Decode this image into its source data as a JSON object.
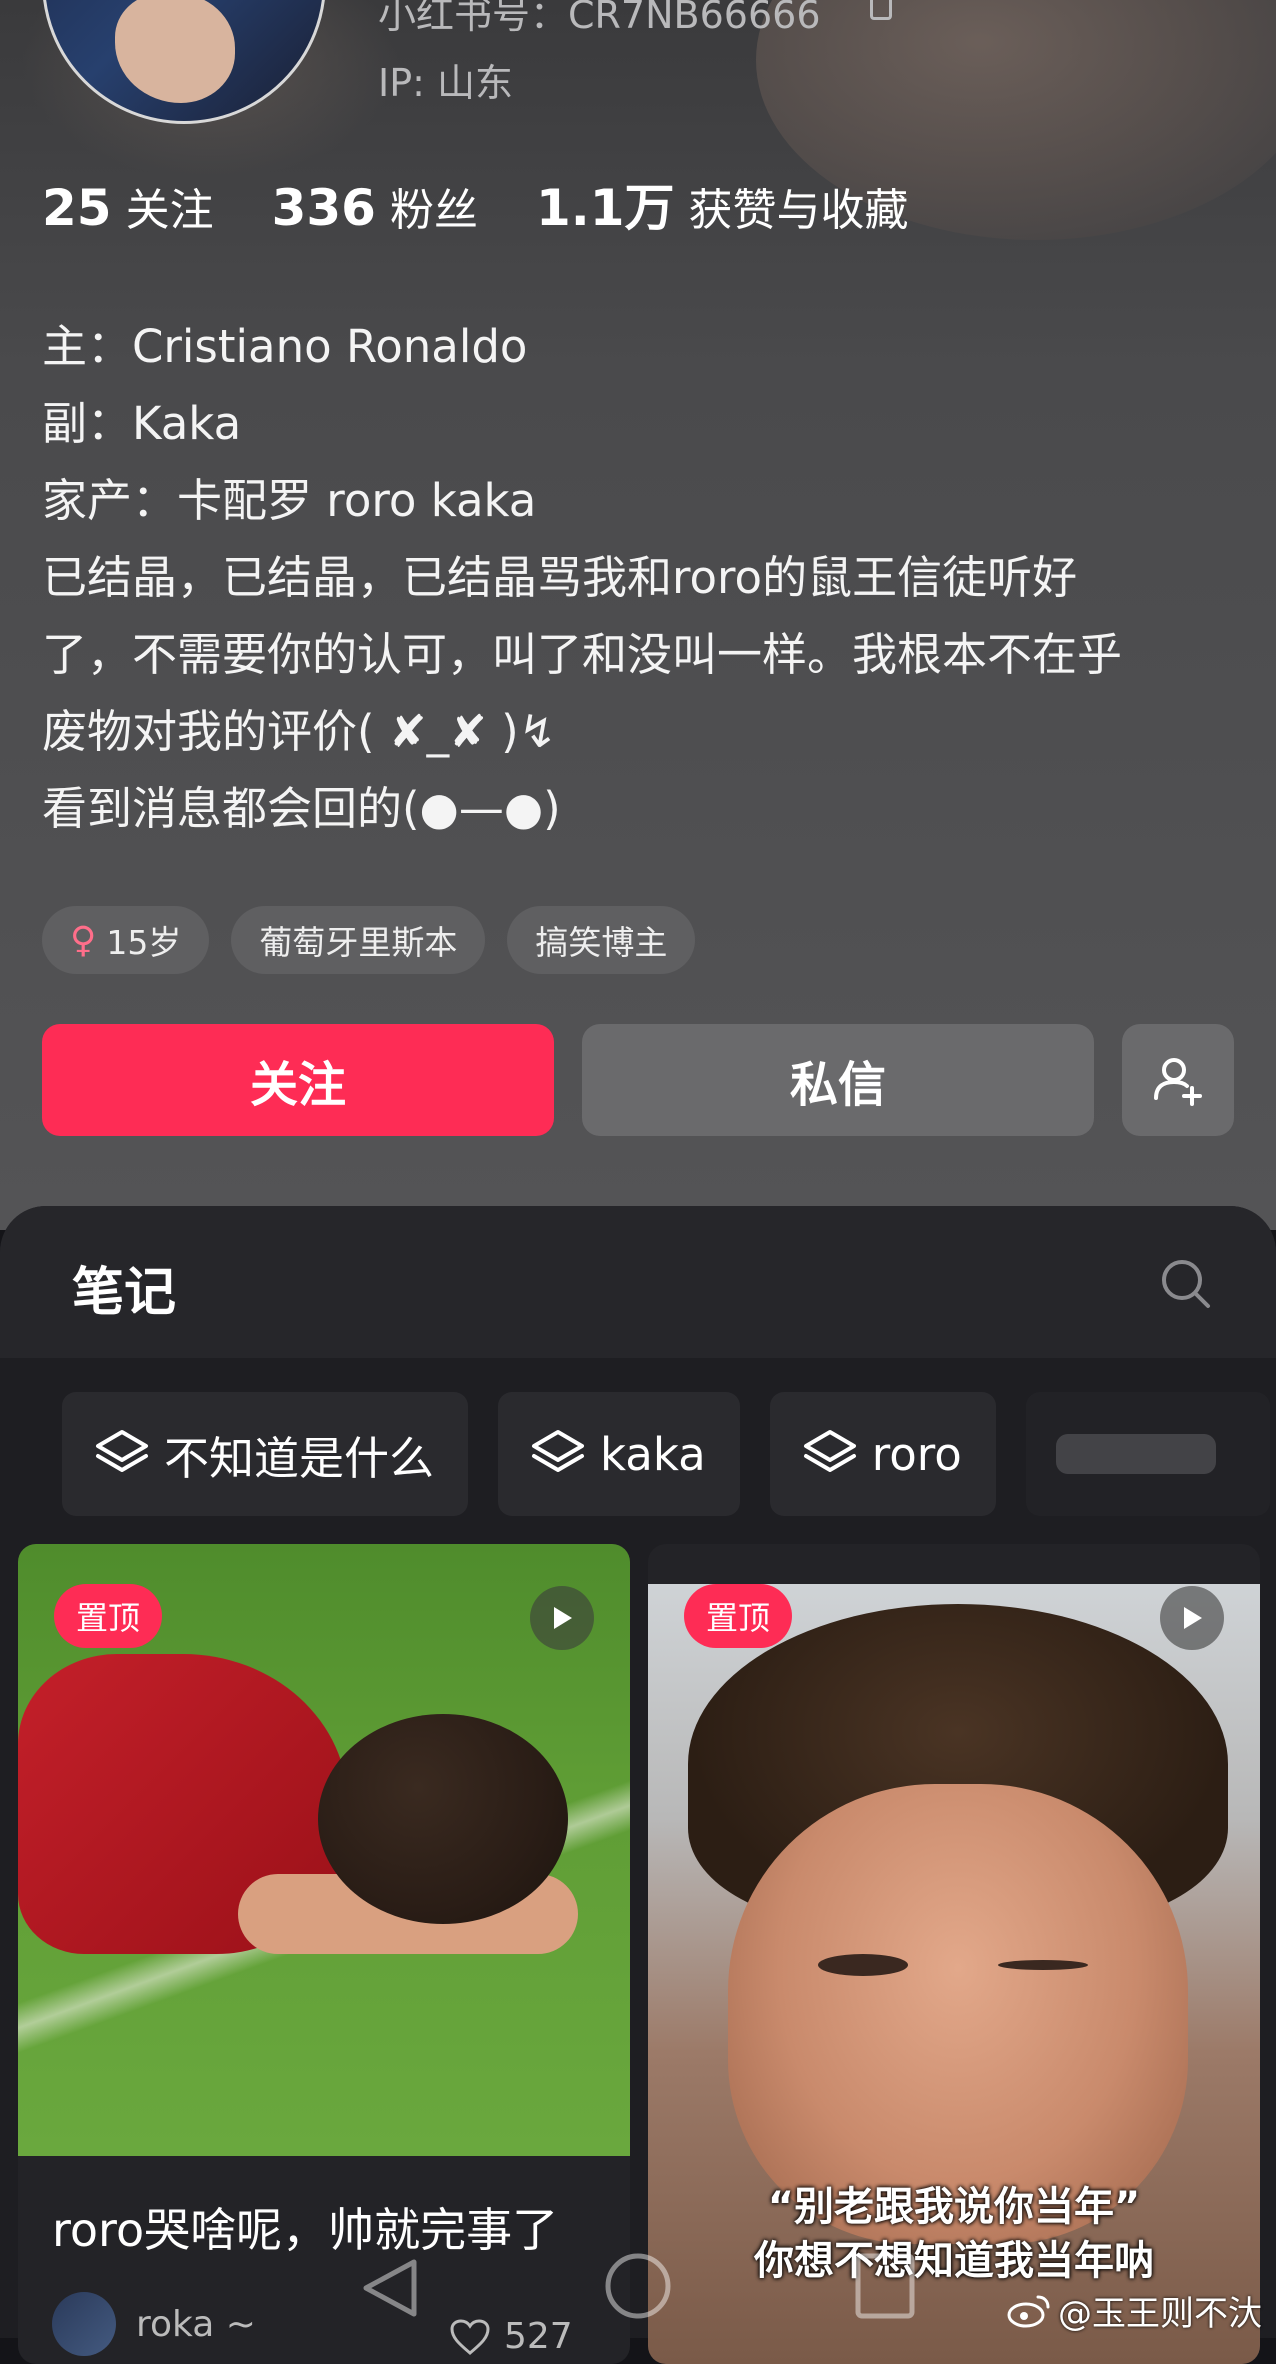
{
  "profile": {
    "rednote_id": "小红书号：CR7NB66666",
    "ip_location": "IP: 山东",
    "stats": [
      {
        "value": "25",
        "label": "关注"
      },
      {
        "value": "336",
        "label": "粉丝"
      },
      {
        "value": "1.1万",
        "label": "获赞与收藏"
      }
    ],
    "bio_lines": [
      "主：Cristiano Ronaldo",
      "副：Kaka",
      "家产：卡配罗 roro kaka",
      "已结晶，已结晶，已结晶骂我和roro的鼠王信徒听好",
      "了，不需要你的认可，叫了和没叫一样。我根本不在乎",
      "废物对我的评价( ✘_✘ )↯",
      "看到消息都会回的(●—●)"
    ],
    "tags": [
      {
        "icon": "female-icon",
        "text": "15岁"
      },
      {
        "text": "葡萄牙里斯本"
      },
      {
        "text": "搞笑博主"
      }
    ],
    "follow_label": "关注",
    "message_label": "私信",
    "add_friend_icon": "add-user-icon"
  },
  "notes": {
    "tab_title": "笔记",
    "search_icon": "search-icon",
    "albums": [
      {
        "icon": "layers-icon",
        "label": "不知道是什么"
      },
      {
        "icon": "layers-icon",
        "label": "kaka"
      },
      {
        "icon": "layers-icon",
        "label": "roro"
      }
    ],
    "cards": [
      {
        "pinned_label": "置顶",
        "is_video": true,
        "title": "roro哭啥呢，帅就完事了",
        "author": "roka ~",
        "likes": "527"
      },
      {
        "pinned_label": "置顶",
        "is_video": true,
        "caption_lines": [
          "“别老跟我说你当年”",
          "你想不想知道我当年呐"
        ]
      }
    ]
  },
  "watermark": "@玉王则不汏",
  "colors": {
    "accent": "#fe2c55",
    "profile_bg": "#4a4a4c",
    "notes_bg": "#1e1e22"
  }
}
